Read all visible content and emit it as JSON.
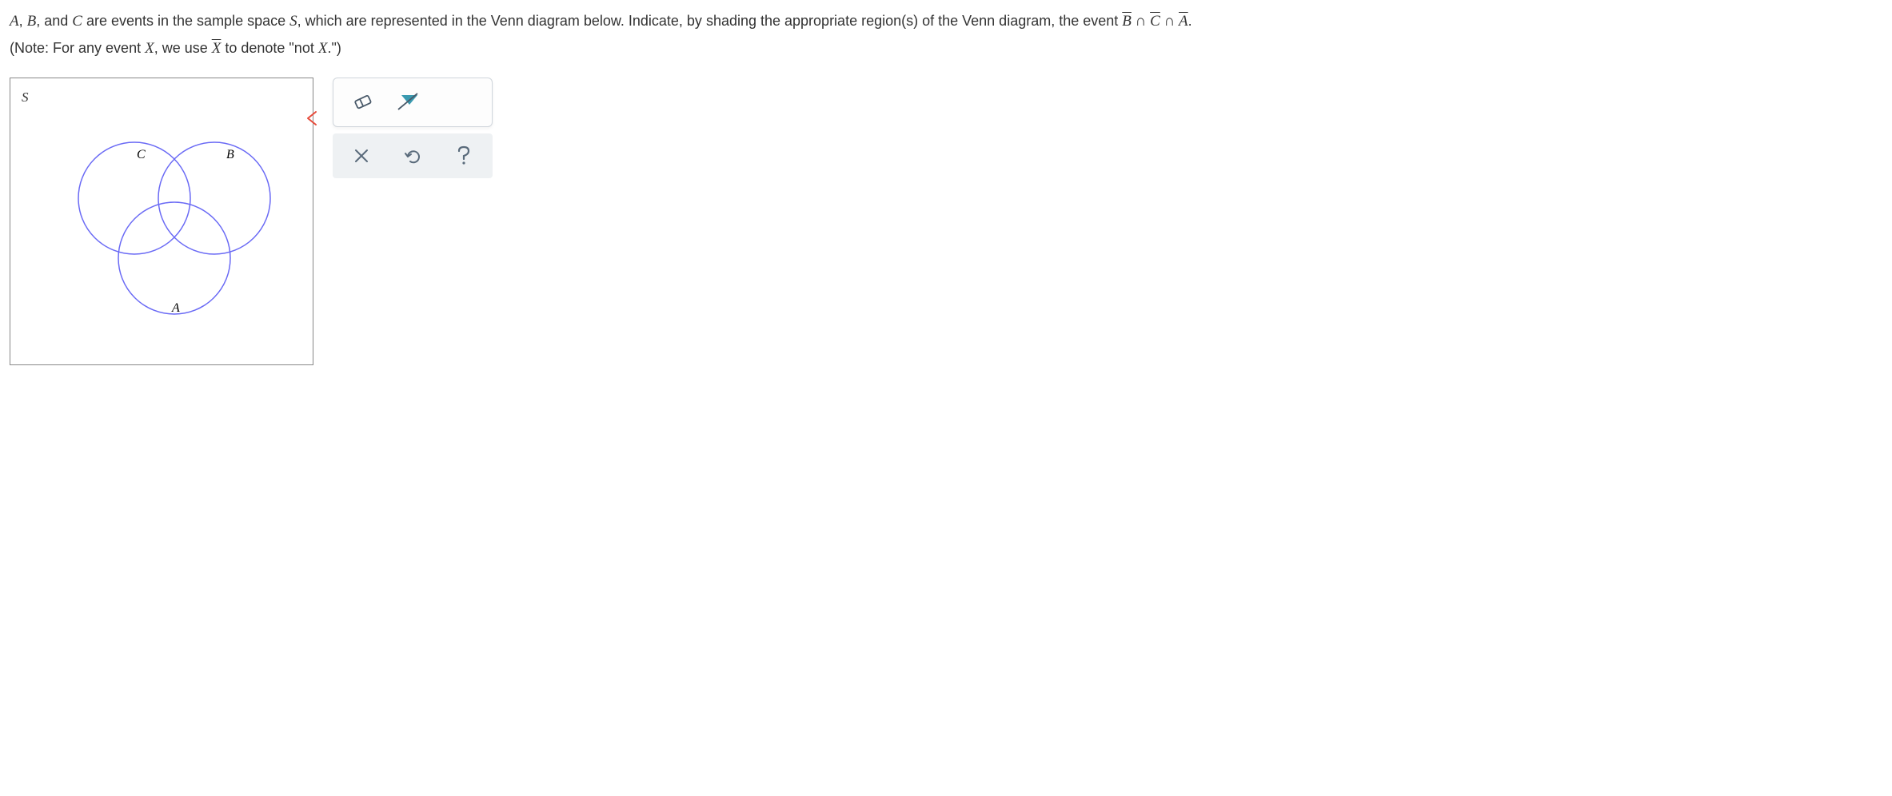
{
  "question": {
    "line1_parts": {
      "p1": "A",
      "p2": ", ",
      "p3": "B",
      "p4": ", and ",
      "p5": "C",
      "p6": " are events in the sample space ",
      "p7": "S",
      "p8": ", which are represented in the Venn diagram below. Indicate, by shading the appropriate region(s) of the Venn diagram, the event ",
      "expr_b": "B",
      "cap1": " ∩ ",
      "expr_c": "C",
      "cap2": " ∩ ",
      "expr_a": "A",
      "period": "."
    },
    "note_parts": {
      "n1": "(Note: For any event ",
      "n2": "X",
      "n3": ", we use ",
      "n4": "X",
      "n5": " to denote \"not ",
      "n6": "X",
      "n7": ".\")"
    }
  },
  "venn": {
    "s_label": "S",
    "c_label": "C",
    "b_label": "B",
    "a_label": "A"
  },
  "tools": {
    "eraser": "eraser",
    "fill": "fill",
    "clear": "clear",
    "undo": "undo",
    "help": "help"
  }
}
